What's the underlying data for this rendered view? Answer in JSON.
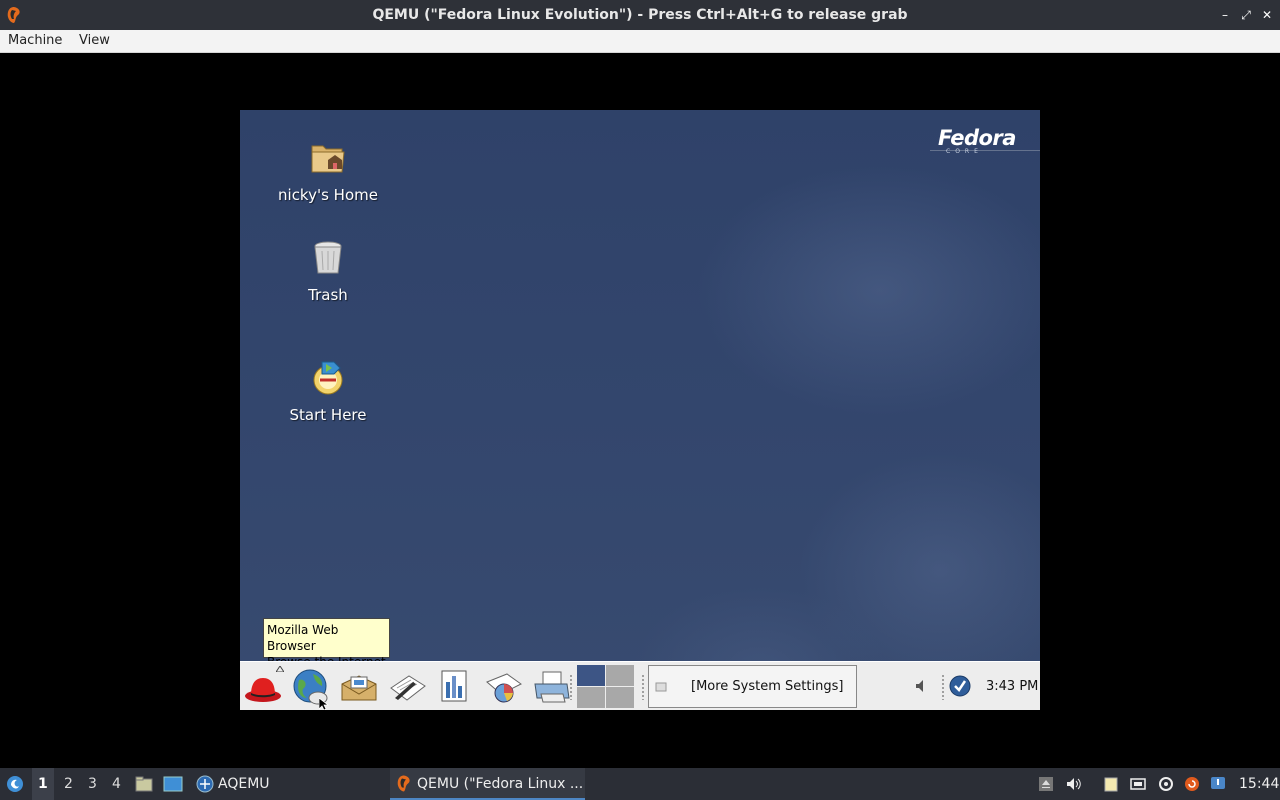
{
  "window": {
    "title": "QEMU (\"Fedora Linux Evolution\") - Press Ctrl+Alt+G to release grab",
    "minimize_glyph": "–",
    "maximize_glyph": "⤢",
    "close_glyph": "✕"
  },
  "menubar": {
    "items": [
      "Machine",
      "View"
    ]
  },
  "guest": {
    "logo": "Fedora",
    "logo_sub": "CORE",
    "desktop_icons": [
      {
        "label": "nicky's Home",
        "icon": "home-folder-icon"
      },
      {
        "label": "Trash",
        "icon": "trash-icon"
      },
      {
        "label": "Start Here",
        "icon": "start-here-icon"
      }
    ],
    "tooltip": {
      "line1": "Mozilla Web Browser",
      "line2": "Browse the Internet"
    },
    "panel": {
      "launchers": [
        "redhat-menu-icon",
        "web-browser-icon",
        "email-icon",
        "text-editor-icon",
        "spreadsheet-icon",
        "presentation-icon",
        "printer-icon"
      ],
      "tasklist_button": "[More System Settings]",
      "clock": "3:43 PM"
    }
  },
  "host_taskbar": {
    "workspaces": [
      "1",
      "2",
      "3",
      "4"
    ],
    "app_launcher_label": "AQEMU",
    "active_task": "QEMU (\"Fedora Linux ...",
    "clock": "15:44"
  },
  "colors": {
    "desktop_bg": "#33466d",
    "tooltip_bg": "#ffffcc",
    "host_bar": "#2b2e36",
    "accent": "#4d86c4"
  }
}
